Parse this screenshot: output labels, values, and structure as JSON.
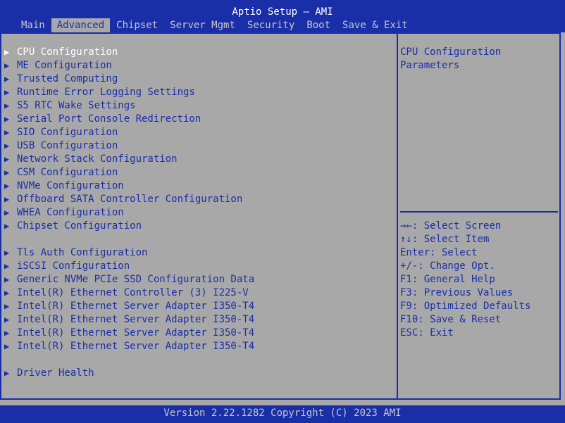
{
  "title": "Aptio Setup – AMI",
  "tabs": [
    {
      "label": "Main"
    },
    {
      "label": "Advanced"
    },
    {
      "label": "Chipset"
    },
    {
      "label": "Server Mgmt"
    },
    {
      "label": "Security"
    },
    {
      "label": "Boot"
    },
    {
      "label": "Save & Exit"
    }
  ],
  "active_tab": "Advanced",
  "menu": [
    {
      "label": "CPU Configuration",
      "selected": true
    },
    {
      "label": "ME Configuration"
    },
    {
      "label": "Trusted Computing"
    },
    {
      "label": "Runtime Error Logging Settings"
    },
    {
      "label": "S5 RTC Wake Settings"
    },
    {
      "label": "Serial Port Console Redirection"
    },
    {
      "label": "SIO Configuration"
    },
    {
      "label": "USB Configuration"
    },
    {
      "label": "Network Stack Configuration"
    },
    {
      "label": "CSM Configuration"
    },
    {
      "label": "NVMe Configuration"
    },
    {
      "label": "Offboard SATA Controller Configuration"
    },
    {
      "label": "WHEA Configuration"
    },
    {
      "label": "Chipset Configuration"
    },
    {
      "blank": true
    },
    {
      "label": "Tls Auth Configuration"
    },
    {
      "label": "iSCSI Configuration"
    },
    {
      "label": "Generic NVMe PCIe SSD Configuration Data"
    },
    {
      "label": "Intel(R) Ethernet Controller (3) I225-V"
    },
    {
      "label": "Intel(R) Ethernet Server Adapter I350-T4"
    },
    {
      "label": "Intel(R) Ethernet Server Adapter I350-T4"
    },
    {
      "label": "Intel(R) Ethernet Server Adapter I350-T4"
    },
    {
      "label": "Intel(R) Ethernet Server Adapter I350-T4"
    },
    {
      "blank": true
    },
    {
      "label": "Driver Health"
    }
  ],
  "help_text": [
    "CPU Configuration",
    "Parameters"
  ],
  "key_help": [
    "→←: Select Screen",
    "↑↓: Select Item",
    "Enter: Select",
    "+/-: Change Opt.",
    "F1: General Help",
    "F3: Previous Values",
    "F9: Optimized Defaults",
    "F10: Save & Reset",
    "ESC: Exit"
  ],
  "footer": "Version 2.22.1282 Copyright (C) 2023 AMI",
  "colors": {
    "header_bg": "#1a2ea8",
    "body_bg": "#a8a8a8",
    "text": "#1a2ea8",
    "selected_text": "#ffffff"
  }
}
